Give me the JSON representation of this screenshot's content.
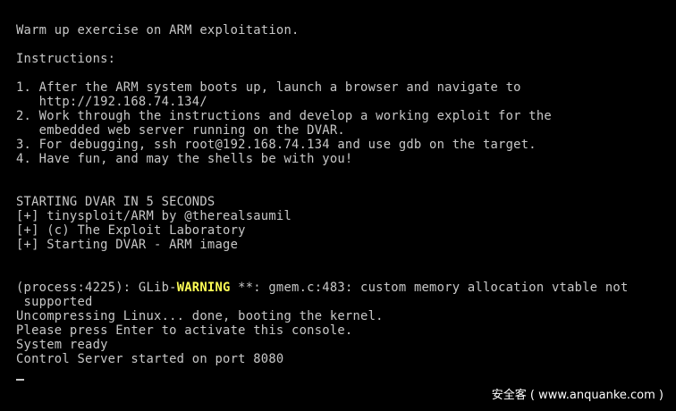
{
  "colors": {
    "background": "#000000",
    "text": "#c8c8c8",
    "warning": "#ffff55"
  },
  "console": {
    "title_line": "Warm up exercise on ARM exploitation.",
    "instructions_heading": "Instructions:",
    "instructions": [
      "1. After the ARM system boots up, launch a browser and navigate to",
      "   http://192.168.74.134/",
      "2. Work through the instructions and develop a working exploit for the",
      "   embedded web server running on the DVAR.",
      "3. For debugging, ssh root@192.168.74.134 and use gdb on the target.",
      "4. Have fun, and may the shells be with you!"
    ],
    "boot_lines": [
      "STARTING DVAR IN 5 SECONDS",
      "[+] tinysploit/ARM by @therealsaumil",
      "[+] (c) The Exploit Laboratory",
      "[+] Starting DVAR - ARM image"
    ],
    "warning": {
      "prefix": "(process:4225): GLib-",
      "level": "WARNING",
      "suffix": " **: gmem.c:483: custom memory allocation vtable not",
      "continuation": " supported"
    },
    "status_lines": [
      "Uncompressing Linux... done, booting the kernel.",
      "Please press Enter to activate this console.",
      "System ready",
      "Control Server started on port 8080"
    ]
  },
  "watermark": "安全客 ( www.anquanke.com )"
}
